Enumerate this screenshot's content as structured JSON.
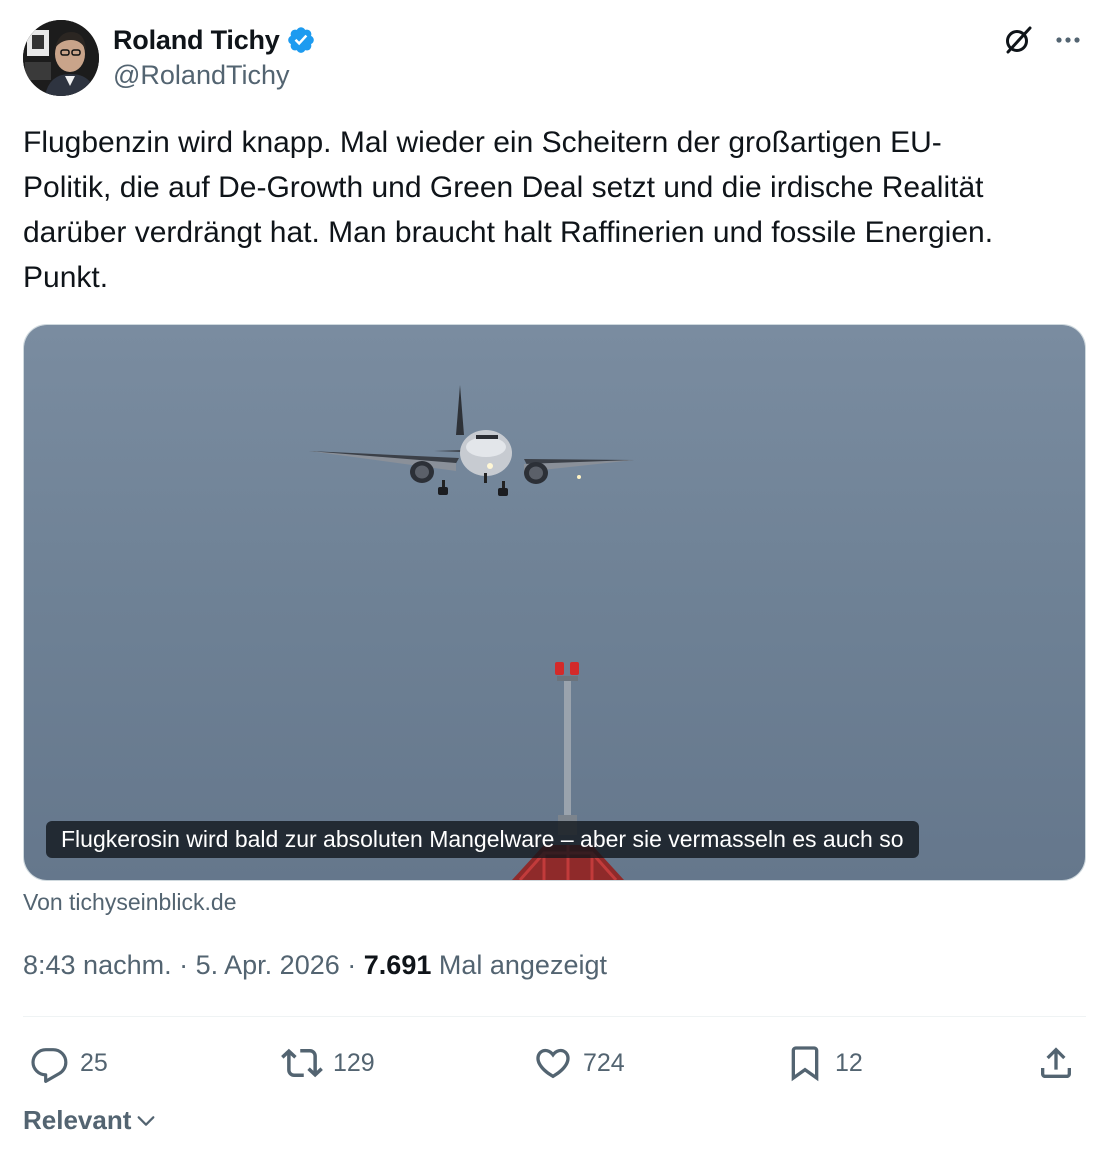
{
  "author": {
    "name": "Roland Tichy",
    "handle": "@RolandTichy",
    "verified": true,
    "verified_color": "#1d9bf0"
  },
  "tweet": {
    "text": "Flugbenzin wird knapp. Mal wieder ein Scheitern der großartigen EU-\nPolitik, die auf De-Growth und Green Deal setzt und die irdische Realität\ndarüber verdrängt hat. Man braucht halt Raffinerien und fossile Energien.\nPunkt."
  },
  "link_card": {
    "image_description_icon": "airplane-landing-photo",
    "caption": "Flugkerosin wird bald zur absoluten Mangelware – aber sie vermasseln es auch so",
    "source": "Von tichyseinblick.de"
  },
  "meta": {
    "time": "8:43 nachm.",
    "separator": "·",
    "date": "5. Apr. 2026",
    "views": "7.691",
    "views_label": "Mal angezeigt"
  },
  "actions": {
    "replies": "25",
    "reposts": "129",
    "likes": "724",
    "bookmarks": "12"
  },
  "sort": {
    "label": "Relevant"
  },
  "colors": {
    "text_primary": "#0f1419",
    "text_secondary": "#536471",
    "border": "#cfd9de",
    "sky": "#6f8296"
  }
}
